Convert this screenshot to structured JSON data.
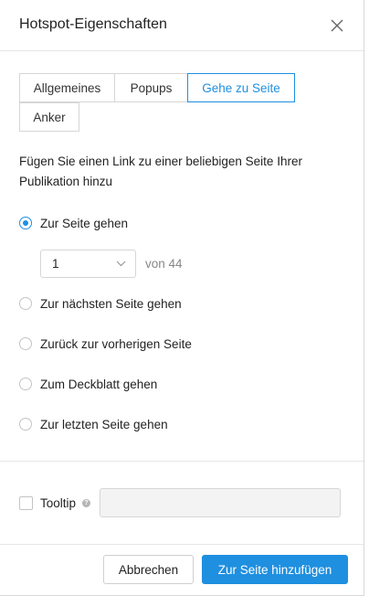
{
  "dialog": {
    "title": "Hotspot-Eigenschaften",
    "close_icon": "close-icon"
  },
  "tabs": [
    {
      "label": "Allgemeines",
      "active": false
    },
    {
      "label": "Popups",
      "active": false
    },
    {
      "label": "Gehe zu Seite",
      "active": true
    },
    {
      "label": "Anker",
      "active": false
    }
  ],
  "description": "Fügen Sie einen Link zu einer beliebigen Seite Ihrer Publikation hinzu",
  "options": [
    {
      "label": "Zur Seite gehen",
      "checked": true
    },
    {
      "label": "Zur nächsten Seite gehen",
      "checked": false
    },
    {
      "label": "Zurück zur vorherigen Seite",
      "checked": false
    },
    {
      "label": "Zum Deckblatt gehen",
      "checked": false
    },
    {
      "label": "Zur letzten Seite gehen",
      "checked": false
    }
  ],
  "page_select": {
    "value": "1",
    "total_label": "von 44"
  },
  "tooltip": {
    "label": "Tooltip",
    "help_icon": "help-icon",
    "help_glyph": "?",
    "checked": false,
    "value": ""
  },
  "footer": {
    "cancel_label": "Abbrechen",
    "submit_label": "Zur Seite hinzufügen"
  },
  "colors": {
    "accent": "#1f8fe0",
    "border": "#d6d6d6",
    "input_bg": "#f3f3f3"
  }
}
